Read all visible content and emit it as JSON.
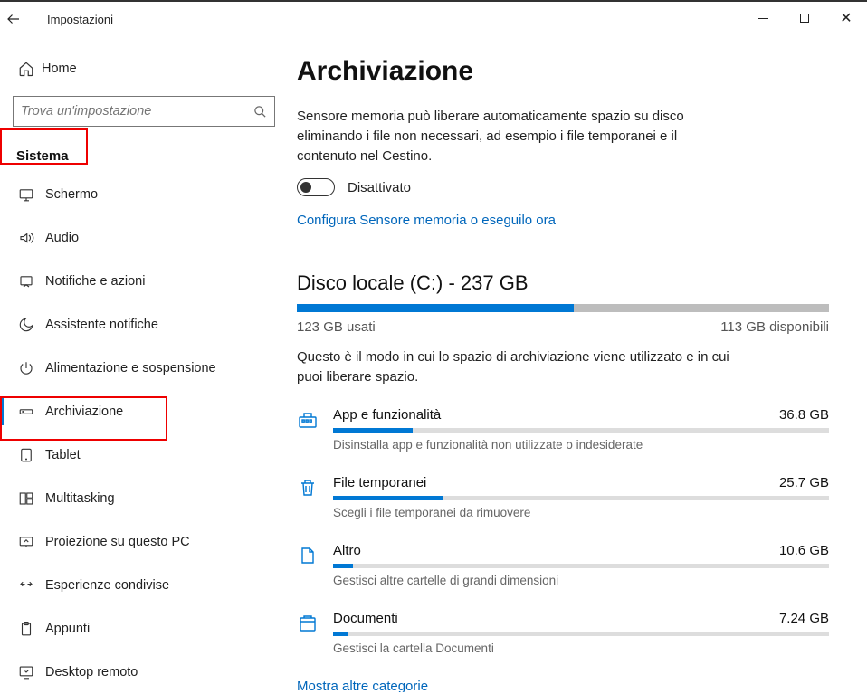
{
  "window": {
    "title": "Impostazioni"
  },
  "sidebar": {
    "home": "Home",
    "search_placeholder": "Trova un'impostazione",
    "section": "Sistema",
    "items": [
      {
        "icon": "display",
        "label": "Schermo"
      },
      {
        "icon": "audio",
        "label": "Audio"
      },
      {
        "icon": "notify",
        "label": "Notifiche e azioni"
      },
      {
        "icon": "focus",
        "label": "Assistente notifiche"
      },
      {
        "icon": "power",
        "label": "Alimentazione e sospensione"
      },
      {
        "icon": "storage",
        "label": "Archiviazione",
        "active": true
      },
      {
        "icon": "tablet",
        "label": "Tablet"
      },
      {
        "icon": "multi",
        "label": "Multitasking"
      },
      {
        "icon": "project",
        "label": "Proiezione su questo PC"
      },
      {
        "icon": "share",
        "label": "Esperienze condivise"
      },
      {
        "icon": "clip",
        "label": "Appunti"
      },
      {
        "icon": "remote",
        "label": "Desktop remoto"
      }
    ]
  },
  "main": {
    "title": "Archiviazione",
    "sense_desc": "Sensore memoria può liberare automaticamente spazio su disco eliminando i file non necessari, ad esempio i file temporanei e il contenuto nel Cestino.",
    "toggle_state": "Disattivato",
    "config_link": "Configura Sensore memoria o eseguilo ora",
    "disk_title": "Disco locale (C:) - 237 GB",
    "disk_used_pct": 52,
    "disk_used": "123 GB usati",
    "disk_free": "113 GB disponibili",
    "disk_desc": "Questo è il modo in cui lo spazio di archiviazione viene utilizzato e in cui puoi liberare spazio.",
    "categories": [
      {
        "icon": "apps",
        "name": "App e funzionalità",
        "size": "36.8 GB",
        "pct": 16,
        "hint": "Disinstalla app e funzionalità non utilizzate o indesiderate"
      },
      {
        "icon": "trash",
        "name": "File temporanei",
        "size": "25.7 GB",
        "pct": 22,
        "hint": "Scegli i file temporanei da rimuovere"
      },
      {
        "icon": "other",
        "name": "Altro",
        "size": "10.6 GB",
        "pct": 4,
        "hint": "Gestisci altre cartelle di grandi dimensioni"
      },
      {
        "icon": "docs",
        "name": "Documenti",
        "size": "7.24 GB",
        "pct": 3,
        "hint": "Gestisci la cartella Documenti"
      }
    ],
    "more_link": "Mostra altre categorie"
  }
}
